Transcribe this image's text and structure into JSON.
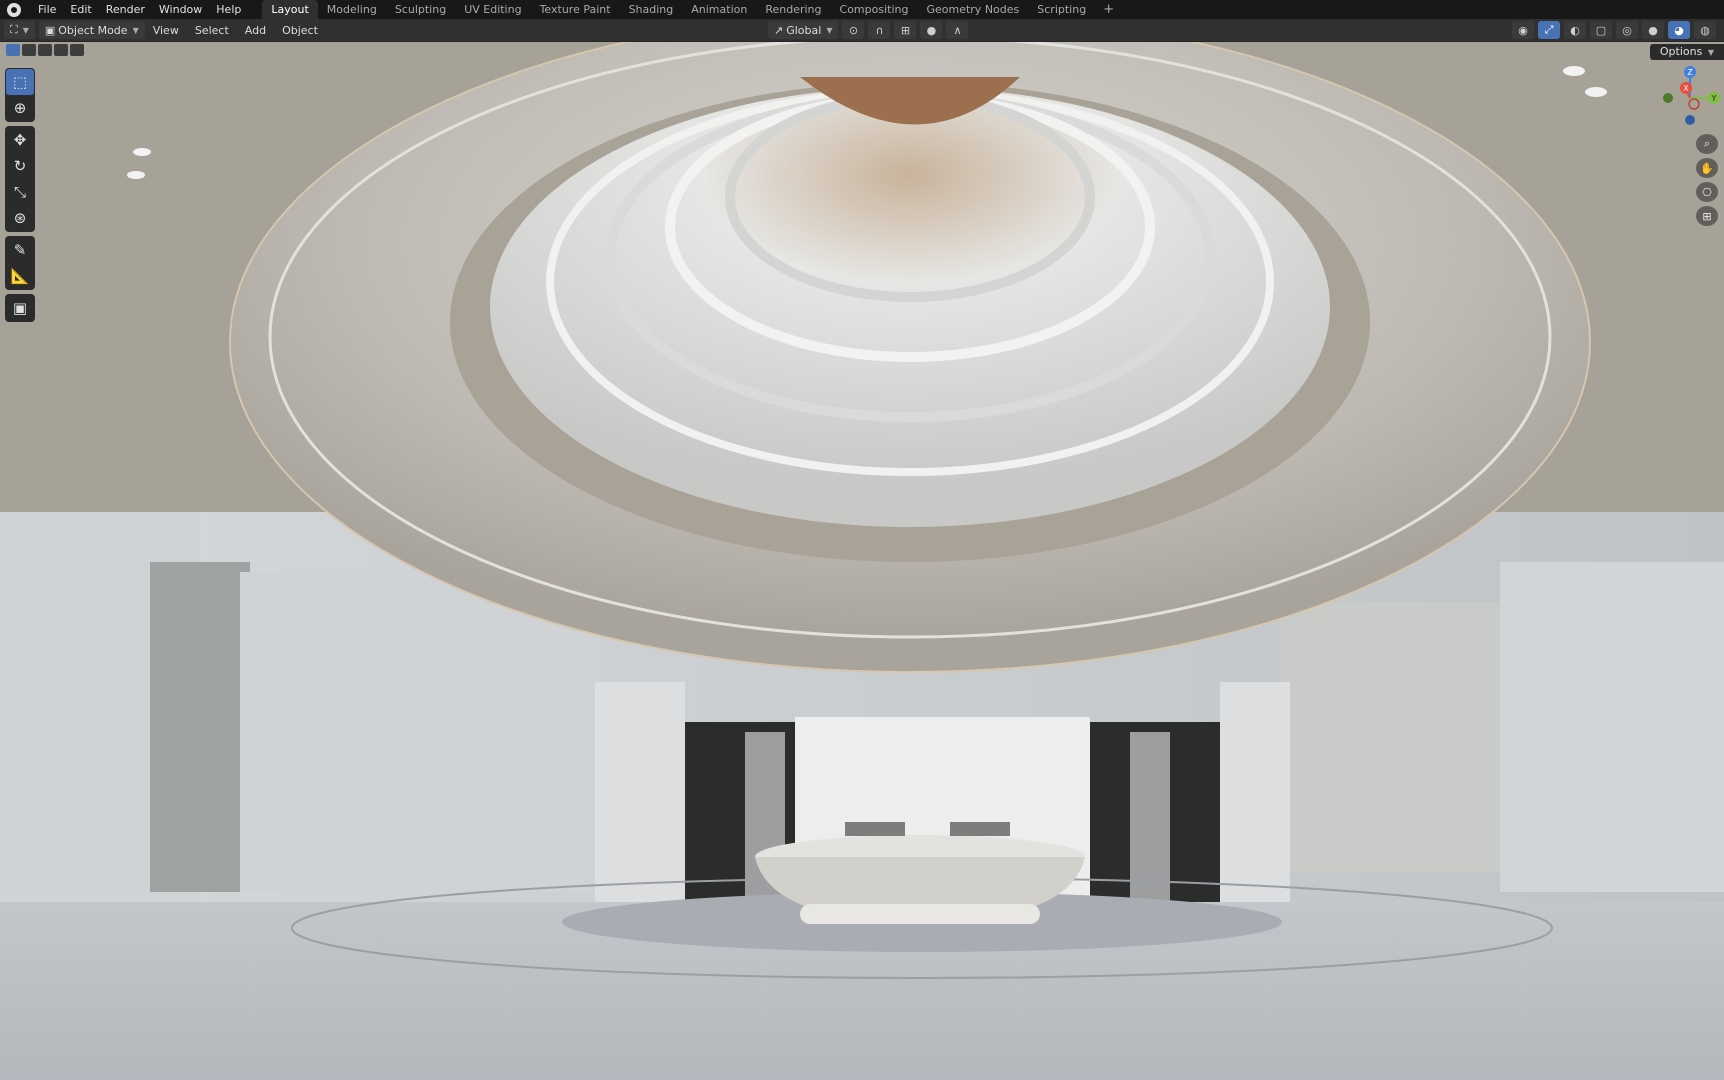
{
  "app": {
    "main_menu": [
      "File",
      "Edit",
      "Render",
      "Window",
      "Help"
    ],
    "workspaces": [
      {
        "label": "Layout",
        "active": true
      },
      {
        "label": "Modeling",
        "active": false
      },
      {
        "label": "Sculpting",
        "active": false
      },
      {
        "label": "UV Editing",
        "active": false
      },
      {
        "label": "Texture Paint",
        "active": false
      },
      {
        "label": "Shading",
        "active": false
      },
      {
        "label": "Animation",
        "active": false
      },
      {
        "label": "Rendering",
        "active": false
      },
      {
        "label": "Compositing",
        "active": false
      },
      {
        "label": "Geometry Nodes",
        "active": false
      },
      {
        "label": "Scripting",
        "active": false
      }
    ],
    "add_workspace": "+"
  },
  "header": {
    "mode": "Object Mode",
    "menus": [
      "View",
      "Select",
      "Add",
      "Object"
    ],
    "transform_orientation": "Global",
    "options_label": "Options"
  },
  "gizmo": {
    "x_label": "X",
    "y_label": "Y",
    "z_label": "Z",
    "x_color": "#e74c3c",
    "y_color": "#7fbf3f",
    "z_color": "#3f7fe0"
  },
  "colors": {
    "accent": "#4772b3",
    "topbar": "#181818",
    "header": "#303030"
  },
  "icons": {
    "toolbar": [
      "select-box-icon",
      "cursor-icon",
      "move-icon",
      "rotate-icon",
      "scale-icon",
      "transform-icon",
      "annotate-icon",
      "measure-icon",
      "add-cube-icon"
    ],
    "nav": [
      "zoom-icon",
      "pan-hand-icon",
      "camera-view-icon",
      "grid-view-icon"
    ]
  }
}
